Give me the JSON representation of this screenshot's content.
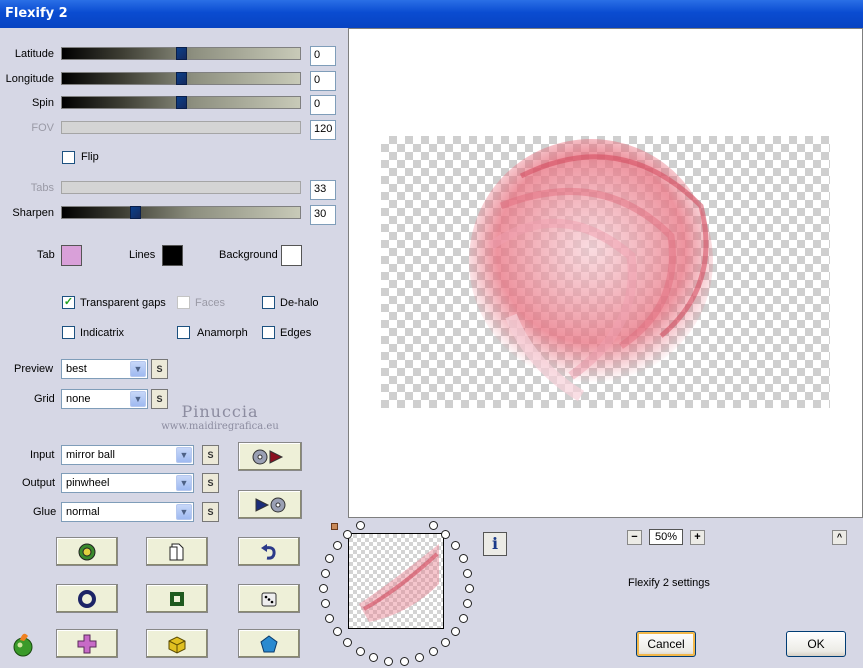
{
  "window": {
    "title": "Flexify 2"
  },
  "sliders": {
    "latitude": {
      "label": "Latitude",
      "value": "0",
      "position": 0.5
    },
    "longitude": {
      "label": "Longitude",
      "value": "0",
      "position": 0.5
    },
    "spin": {
      "label": "Spin",
      "value": "0",
      "position": 0.5
    },
    "fov": {
      "label": "FOV",
      "value": "120"
    },
    "tabs": {
      "label": "Tabs",
      "value": "33"
    },
    "sharpen": {
      "label": "Sharpen",
      "value": "30",
      "position": 0.3
    }
  },
  "flip": {
    "label": "Flip",
    "checked": false
  },
  "colors": {
    "tab": {
      "label": "Tab",
      "color": "#d9a0d9"
    },
    "lines": {
      "label": "Lines",
      "color": "#000000"
    },
    "background": {
      "label": "Background",
      "color": "#ffffff"
    }
  },
  "options": {
    "transparent_gaps": {
      "label": "Transparent gaps",
      "checked": true
    },
    "faces": {
      "label": "Faces",
      "checked": false
    },
    "de_halo": {
      "label": "De-halo",
      "checked": false
    },
    "indicatrix": {
      "label": "Indicatrix",
      "checked": false
    },
    "anamorph": {
      "label": "Anamorph",
      "checked": false
    },
    "edges": {
      "label": "Edges",
      "checked": false
    }
  },
  "dropdowns": {
    "preview": {
      "label": "Preview",
      "value": "best"
    },
    "grid": {
      "label": "Grid",
      "value": "none"
    },
    "input": {
      "label": "Input",
      "value": "mirror ball"
    },
    "output": {
      "label": "Output",
      "value": "pinwheel"
    },
    "glue": {
      "label": "Glue",
      "value": "normal"
    }
  },
  "s_label": "S",
  "watermark": {
    "name": "Pinuccia",
    "url": "www.maidiregrafica.eu"
  },
  "zoom": {
    "value": "50%",
    "minus": "−",
    "plus": "+"
  },
  "settings_text": "Flexify 2 settings",
  "buttons": {
    "cancel": "Cancel",
    "ok": "OK",
    "info": "i",
    "collapse": "^"
  }
}
